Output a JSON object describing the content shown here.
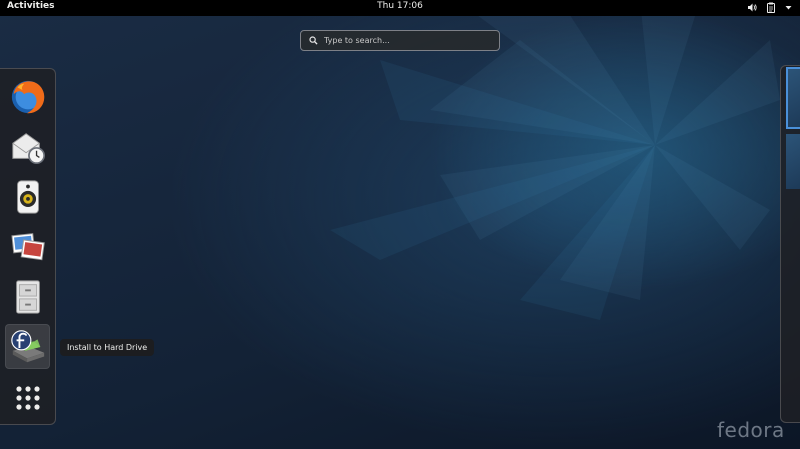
{
  "top_bar": {
    "activities_label": "Activities",
    "clock": "Thu 17:06",
    "status_icons": [
      "volume-icon",
      "clipboard-icon",
      "system-menu-arrow-icon"
    ]
  },
  "search": {
    "placeholder": "Type to search...",
    "icon": "search-icon"
  },
  "dash": {
    "items": [
      {
        "name": "Firefox",
        "icon": "firefox-icon"
      },
      {
        "name": "Evolution",
        "icon": "mail-clock-icon"
      },
      {
        "name": "Rhythmbox",
        "icon": "speaker-icon"
      },
      {
        "name": "Shotwell",
        "icon": "photos-icon"
      },
      {
        "name": "Files",
        "icon": "file-cabinet-icon"
      },
      {
        "name": "Install to Hard Drive",
        "icon": "fedora-install-icon"
      },
      {
        "name": "Show Applications",
        "icon": "app-grid-icon"
      }
    ],
    "tooltip": "Install to Hard Drive"
  },
  "workspaces": {
    "count": 2,
    "active_index": 0
  },
  "branding": {
    "logo_text": "fedora"
  },
  "colors": {
    "accent": "#4a90d9",
    "top_bar": "#000000",
    "background": "#16263c"
  }
}
